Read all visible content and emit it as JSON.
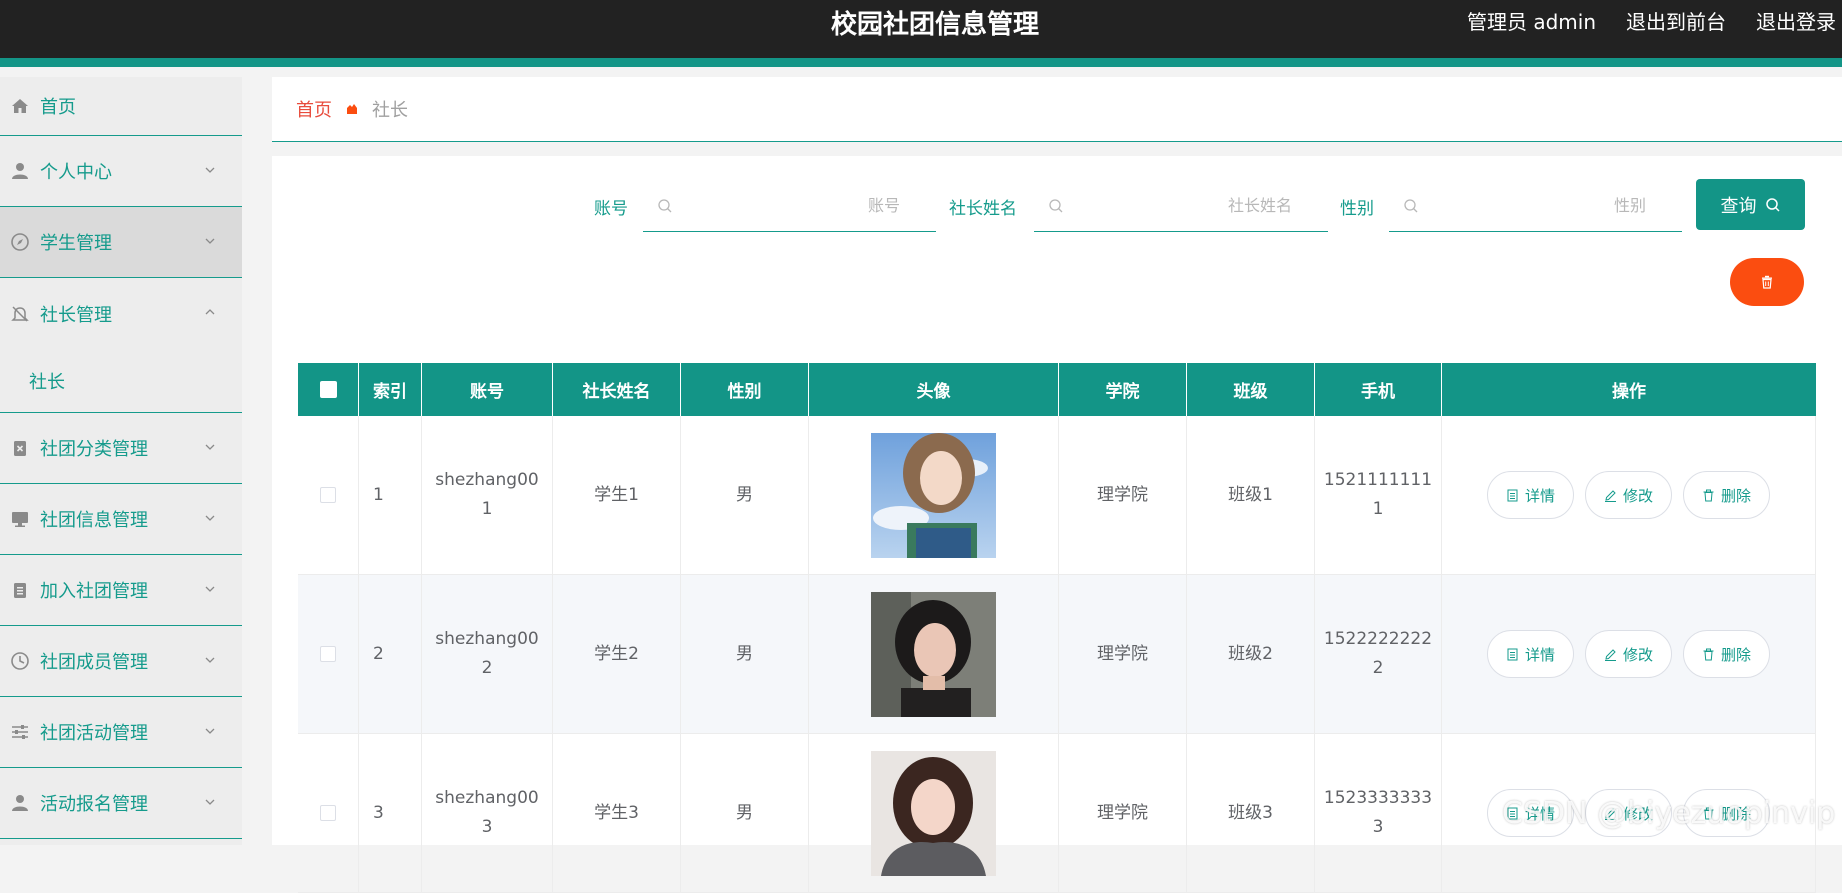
{
  "header": {
    "title": "校园社团信息管理",
    "admin_label": "管理员 admin",
    "to_front": "退出到前台",
    "logout": "退出登录"
  },
  "sidebar": {
    "items": [
      {
        "label": "首页",
        "icon": "home-icon"
      },
      {
        "label": "个人中心",
        "icon": "user-icon"
      },
      {
        "label": "学生管理",
        "icon": "compass-icon"
      },
      {
        "label": "社长管理",
        "icon": "bell-off-icon",
        "sub": [
          "社长"
        ]
      },
      {
        "label": "社团分类管理",
        "icon": "clipboard-x-icon"
      },
      {
        "label": "社团信息管理",
        "icon": "monitor-icon"
      },
      {
        "label": "加入社团管理",
        "icon": "clipboard-icon"
      },
      {
        "label": "社团成员管理",
        "icon": "clock-icon"
      },
      {
        "label": "社团活动管理",
        "icon": "sliders-icon"
      },
      {
        "label": "活动报名管理",
        "icon": "user-icon"
      }
    ]
  },
  "breadcrumb": {
    "home": "首页",
    "current": "社长"
  },
  "search": {
    "account_label": "账号",
    "account_placeholder": "账号",
    "name_label": "社长姓名",
    "name_placeholder": "社长姓名",
    "gender_label": "性别",
    "gender_placeholder": "性别",
    "query_label": "查询"
  },
  "table": {
    "headers": [
      "",
      "索引",
      "账号",
      "社长姓名",
      "性别",
      "头像",
      "学院",
      "班级",
      "手机",
      "操作"
    ],
    "rows": [
      {
        "index": "1",
        "account": "shezhang001",
        "name": "学生1",
        "gender": "男",
        "college": "理学院",
        "class": "班级1",
        "phone": "15211111111"
      },
      {
        "index": "2",
        "account": "shezhang002",
        "name": "学生2",
        "gender": "男",
        "college": "理学院",
        "class": "班级2",
        "phone": "15222222222"
      },
      {
        "index": "3",
        "account": "shezhang003",
        "name": "学生3",
        "gender": "男",
        "college": "理学院",
        "class": "班级3",
        "phone": "15233333333"
      }
    ],
    "actions": {
      "detail": "详情",
      "edit": "修改",
      "delete": "删除"
    }
  },
  "watermark": "CSDN @biyezuopinvip",
  "colors": {
    "primary": "#139587",
    "danger": "#fb4d10",
    "topbar": "#222222"
  }
}
